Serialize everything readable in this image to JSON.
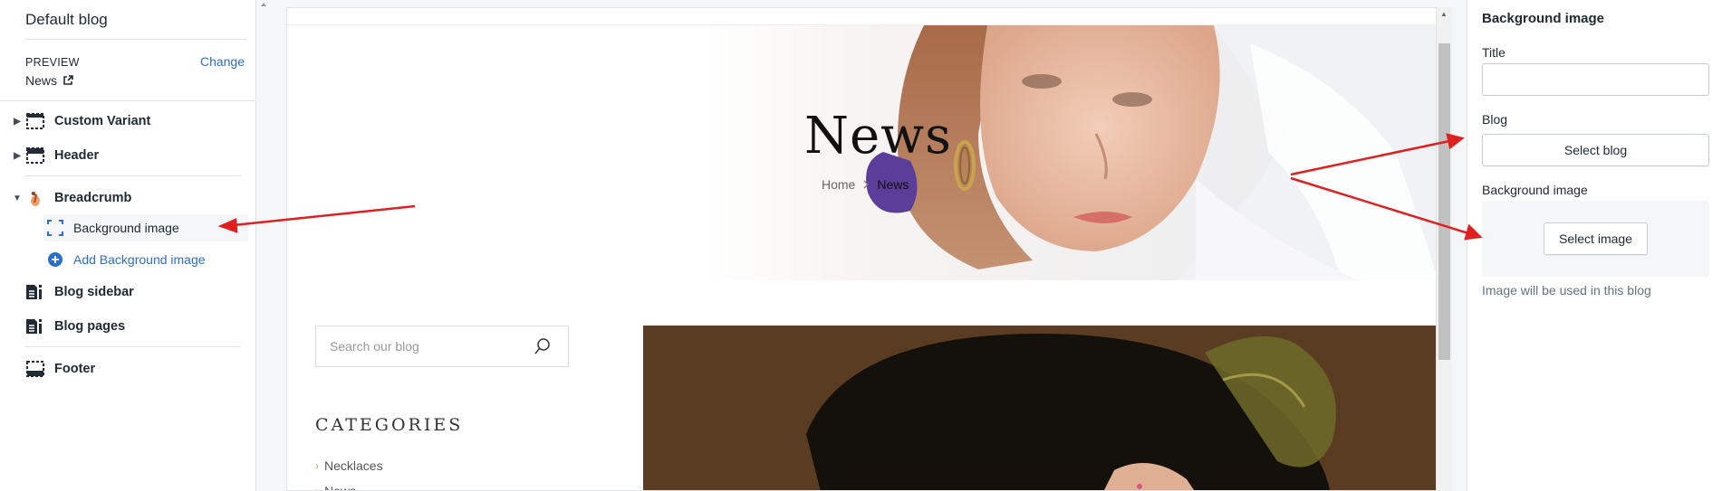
{
  "sidebar": {
    "title": "Default blog",
    "preview_label": "PREVIEW",
    "change_link": "Change",
    "preview_value": "News",
    "sections": [
      {
        "label": "Custom Variant",
        "icon": "section-icon"
      },
      {
        "label": "Header",
        "icon": "header-icon"
      },
      {
        "label": "Breadcrumb",
        "icon": "breadcrumb-app-icon"
      },
      {
        "label": "Blog sidebar",
        "icon": "blog-icon"
      },
      {
        "label": "Blog pages",
        "icon": "blog-icon"
      },
      {
        "label": "Footer",
        "icon": "footer-icon"
      }
    ],
    "breadcrumb_children": [
      {
        "label": "Background image",
        "icon": "dashed-square-icon"
      },
      {
        "label": "Add Background image",
        "icon": "plus-circle-icon"
      }
    ]
  },
  "preview": {
    "hero_title": "News",
    "breadcrumb_home": "Home",
    "breadcrumb_current": "News",
    "search_placeholder": "Search our blog",
    "categories_title": "CATEGORIES",
    "categories": [
      "Necklaces",
      "News"
    ]
  },
  "panel": {
    "title": "Background image",
    "title_field_label": "Title",
    "title_field_value": "",
    "blog_label": "Blog",
    "select_blog_button": "Select blog",
    "bg_image_label": "Background image",
    "select_image_button": "Select image",
    "help_text": "Image will be used in this blog"
  },
  "colors": {
    "link_blue": "#2c6ecb",
    "annotation_red": "#e02020"
  }
}
